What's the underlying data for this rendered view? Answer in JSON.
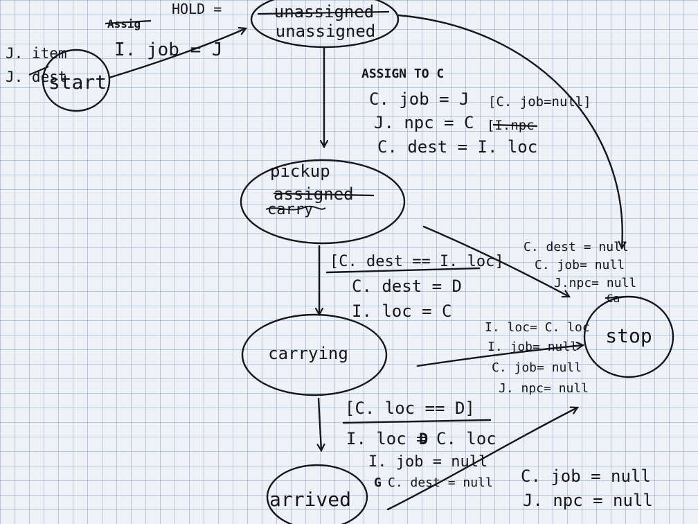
{
  "states": {
    "start": "start",
    "unassigned_old": "unassigned",
    "unassigned": "unassigned",
    "pickup": "pickup",
    "pickup_old1": "assigned",
    "pickup_old2": "carry",
    "carrying": "carrying",
    "arrived": "arrived",
    "stop": "stop"
  },
  "start_notes": [
    "J. item",
    "J. dest"
  ],
  "start_to_unassigned": {
    "struck": "Assig",
    "label": "HOLD =",
    "action": "I. job = J"
  },
  "unassigned_to_pickup": {
    "heading": "ASSIGN TO C",
    "actions": [
      "C. job = J",
      "J. npc = C",
      "C. dest = I. loc"
    ],
    "guard": "[C. job=null]",
    "guard2_struck": "[I.npc"
  },
  "pickup_to_carrying": {
    "guard": "[C. dest == I. loc]",
    "actions": [
      "C. dest = D",
      "I. loc = C"
    ]
  },
  "pickup_to_stop": {
    "actions": [
      "C. dest = null",
      "C. job= null",
      "J.npc= null"
    ],
    "struck": "Ca"
  },
  "carrying_to_stop": {
    "actions": [
      "I. loc= C. loc",
      "I. job= null",
      "C. job= null",
      "J. npc= null"
    ]
  },
  "carrying_to_arrived": {
    "guard": "[C. loc == D]",
    "actions": [
      "I. loc = C. loc",
      "I. job = null",
      "C. dest = null"
    ],
    "struck_prefix": "D",
    "struck_prefix2": "G"
  },
  "arrived_to_stop": {
    "actions": [
      "C. job = null",
      "J. npc = null"
    ]
  }
}
